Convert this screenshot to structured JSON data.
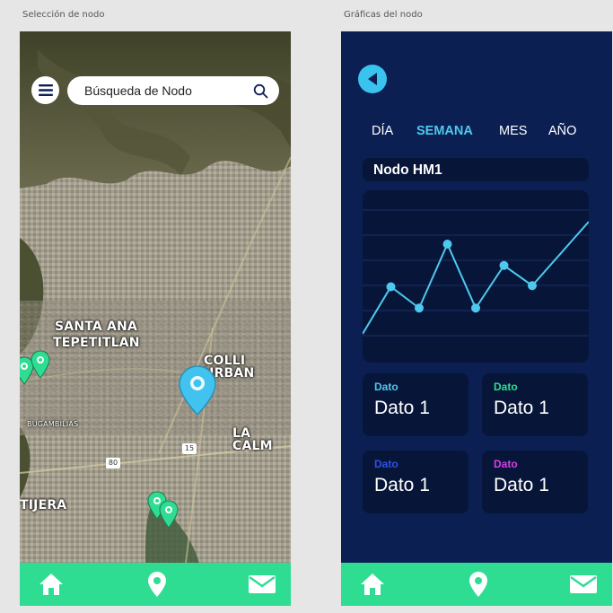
{
  "left_frame": {
    "label": "Selección de nodo",
    "search": {
      "placeholder": "Búsqueda de Nodo"
    },
    "map_labels": {
      "santa_ana": "SANTA ANA",
      "tepetitlan": "TEPETITLAN",
      "colli": "COLLI URBAN",
      "calma": "LA CALM",
      "bugambilias": "BUGAMBILIAS",
      "tijera": "TIJERA",
      "shield_80": "80",
      "shield_15": "15"
    }
  },
  "right_frame": {
    "label": "Gráficas del nodo",
    "tabs": [
      "DÍA",
      "SEMANA",
      "MES",
      "AÑO"
    ],
    "active_tab": "SEMANA",
    "node_title": "Nodo HM1",
    "cards": [
      {
        "label": "Dato",
        "value": "Dato 1",
        "label_color": "#4fc8ef"
      },
      {
        "label": "Dato",
        "value": "Dato 1",
        "label_color": "#2edd92"
      },
      {
        "label": "Dato",
        "value": "Dato 1",
        "label_color": "#2f4fe8"
      },
      {
        "label": "Dato",
        "value": "Dato 1",
        "label_color": "#d43fe8"
      }
    ]
  },
  "colors": {
    "nav_bar": "#2edd92",
    "graph_bg": "#0b1f52",
    "panel_bg": "#071638",
    "accent": "#38c4ee",
    "selected_pin": "#42c2ef",
    "node_pin": "#2edd92"
  },
  "icons": {
    "menu": "menu-icon",
    "search": "search-icon",
    "back": "back-arrow-icon",
    "home": "home-icon",
    "location": "location-icon",
    "mail": "mail-icon"
  },
  "chart_data": {
    "type": "line",
    "x": [
      1,
      2,
      3,
      4,
      5,
      6,
      7,
      8,
      9
    ],
    "values": [
      0.0,
      0.42,
      0.23,
      0.8,
      0.23,
      0.61,
      0.43,
      null,
      1.0
    ],
    "markers": [
      false,
      true,
      true,
      true,
      true,
      true,
      true,
      false,
      false
    ],
    "ylim": [
      0,
      1
    ],
    "grid": true,
    "title": "",
    "xlabel": "",
    "ylabel": ""
  }
}
